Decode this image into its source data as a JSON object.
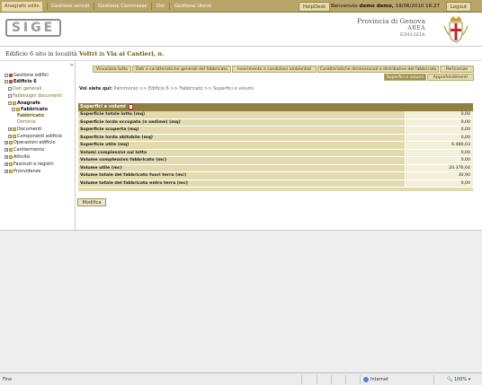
{
  "topmenu": {
    "tabs": [
      "Anagrafe edile",
      "Gestione servizi",
      "Gestione Commesse",
      "Dol",
      "Gestione Utenti"
    ],
    "helpdesk": "HelpDesk",
    "welcome_prefix": "Benvenuto",
    "user": "demo demo,",
    "datetime": "19/06/2010 18:27",
    "logout": "Logout"
  },
  "header": {
    "logo_text": "SIGE",
    "province": "Provincia di Genova",
    "area": "AREA",
    "area_name": "EDILIZIA"
  },
  "edificio": {
    "prefix": "Edificio",
    "id": "6",
    "middle": "sito in località",
    "locality": "Voltri",
    "in": "in",
    "street": "Via ai Cantieri, n."
  },
  "sidebar": {
    "items": [
      {
        "label": "Gestione edifici",
        "icon": "house-icon"
      },
      {
        "label": "Edificio 6",
        "icon": "house-icon"
      },
      {
        "label": "Dati generali",
        "icon": "page-icon"
      },
      {
        "label": "Fabbisogni documenti",
        "icon": "page-icon"
      },
      {
        "label": "Anagrafe",
        "icon": "folder-icon"
      },
      {
        "label": "Fabbricato",
        "icon": "folder-icon"
      },
      {
        "label": "Fabbricato",
        "icon": "page-icon"
      },
      {
        "label": "Dominio",
        "icon": "page-icon"
      },
      {
        "label": "Documenti",
        "icon": "folder-icon"
      },
      {
        "label": "Componenti edificio",
        "icon": "folder-icon"
      },
      {
        "label": "Operazioni edificio",
        "icon": "folder-icon"
      },
      {
        "label": "Cantiermento",
        "icon": "folder-icon"
      },
      {
        "label": "Attività",
        "icon": "folder-icon"
      },
      {
        "label": "Fascicoli e registri",
        "icon": "folder-icon"
      },
      {
        "label": "Provvidenze",
        "icon": "folder-icon"
      }
    ]
  },
  "tabs": {
    "row1": [
      "Visualizza tutto",
      "Dati e caratteristiche generali del fabbricato",
      "Inserimento e condizioni ambientali",
      "Caratteristiche dimensionali e distributive del fabbricato",
      "Pertinenze"
    ],
    "row2": [
      "Superfici e volumi",
      "Approfondimenti"
    ]
  },
  "breadcrumb": {
    "label": "Voi siete qui:",
    "path": "Patrimonio >> Edificio 6 >> Fabbricato >> Superfici e volumi"
  },
  "table": {
    "title": "Superfici e volumi",
    "rows": [
      {
        "label": "Superficie totale lotto (mq)",
        "value": "0,00"
      },
      {
        "label": "Superficie lorda occupata (n sedime) (mq)",
        "value": "0,00"
      },
      {
        "label": "Superficie scoperta (mq)",
        "value": "0,00"
      },
      {
        "label": "Superficie lorda abitabile (mq)",
        "value": "0,00"
      },
      {
        "label": "Superficie utile (mq)",
        "value": "6.480,03"
      },
      {
        "label": "Volumi complessivi sul lotto",
        "value": "0,00"
      },
      {
        "label": "Volume complessivo fabbricato (mc)",
        "value": "0,00"
      },
      {
        "label": "Volume utile (mc)",
        "value": "20.376,64"
      },
      {
        "label": "Volume totale del fabbricato fuori terra (mc)",
        "value": "30,90"
      },
      {
        "label": "Volume totale del fabbricato entro terra (mc)",
        "value": "0,00"
      }
    ]
  },
  "modify_button": "Modifica",
  "statusbar": {
    "left": "Fine",
    "zone": "Internet",
    "zoom": "100%"
  }
}
